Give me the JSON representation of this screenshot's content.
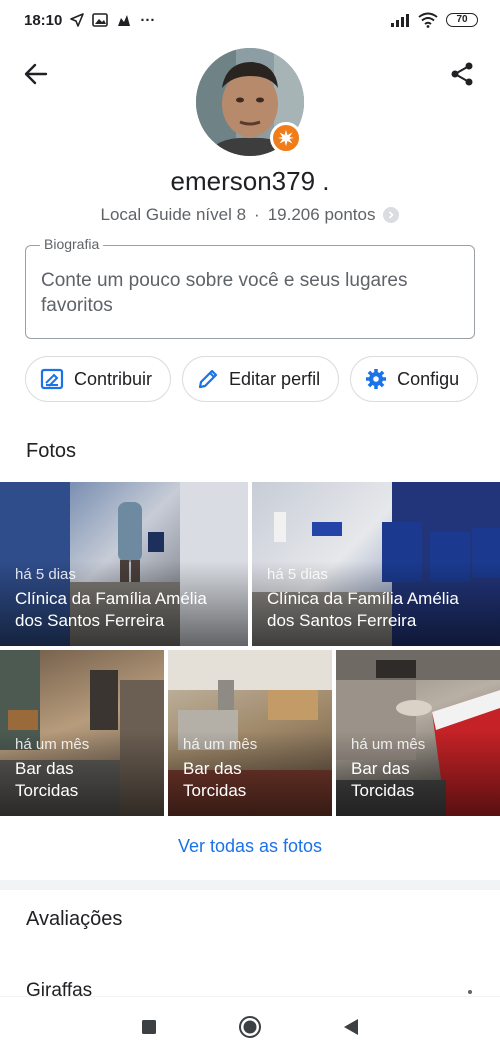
{
  "status_bar": {
    "time": "18:10",
    "notification_icons": [
      "navigation-arrow-icon",
      "image-notification-icon",
      "app-notification-icon"
    ],
    "more": "···",
    "battery": "70"
  },
  "profile": {
    "username": "emerson379 .",
    "level": "Local Guide nível 8",
    "separator": "·",
    "points": "19.206 pontos"
  },
  "bio": {
    "label": "Biografia",
    "placeholder": "Conte um pouco sobre você e seus lugares favoritos"
  },
  "chips": {
    "contribute": "Contribuir",
    "edit_profile": "Editar perfil",
    "settings": "Configu"
  },
  "photos": {
    "title": "Fotos",
    "items": [
      {
        "when": "há 5 dias",
        "place_line1": "Clínica da Família Amélia",
        "place_line2": "dos Santos Ferreira"
      },
      {
        "when": "há 5 dias",
        "place_line1": "Clínica da Família Amélia",
        "place_line2": "dos Santos Ferreira"
      },
      {
        "when": "há um mês",
        "place_line1": "Bar das",
        "place_line2": "Torcidas"
      },
      {
        "when": "há um mês",
        "place_line1": "Bar das",
        "place_line2": "Torcidas"
      },
      {
        "when": "há um mês",
        "place_line1": "Bar das",
        "place_line2": "Torcidas"
      }
    ],
    "see_all": "Ver todas as fotos"
  },
  "reviews": {
    "title": "Avaliações",
    "first_place": "Giraffas"
  },
  "colors": {
    "accent": "#1a73e8",
    "badge": "#f07c1a",
    "text_primary": "#202124",
    "text_secondary": "#5f6368"
  }
}
